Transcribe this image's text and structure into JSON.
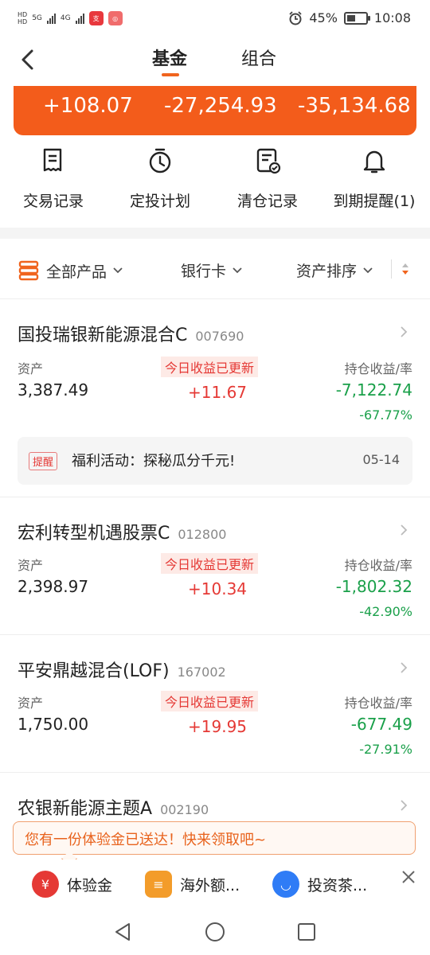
{
  "status_bar": {
    "network_left": "5G",
    "network_right": "4G",
    "app_badge": "支",
    "battery": "45%",
    "battery_level": 0.45,
    "time": "10:08"
  },
  "header": {
    "tabs": [
      {
        "label": "基金",
        "active": true
      },
      {
        "label": "组合",
        "active": false
      }
    ]
  },
  "summary": {
    "values": [
      "+108.07",
      "-27,254.93",
      "-35,134.68"
    ]
  },
  "quick_actions": [
    {
      "label": "交易记录",
      "icon": "receipt-icon"
    },
    {
      "label": "定投计划",
      "icon": "timer-icon"
    },
    {
      "label": "清仓记录",
      "icon": "checked-doc-icon"
    },
    {
      "label": "到期提醒(1)",
      "icon": "bell-icon"
    }
  ],
  "filters": {
    "all_products": "全部产品",
    "bank_card": "银行卡",
    "asset_sort": "资产排序"
  },
  "labels": {
    "asset": "资产",
    "today_updated": "今日收益已更新",
    "holding_profit": "持仓收益/率"
  },
  "funds": [
    {
      "name": "国投瑞银新能源混合C",
      "code": "007690",
      "asset": "3,387.49",
      "today": "+11.67",
      "profit": "-7,122.74",
      "rate": "-67.77%",
      "notice": {
        "tag": "提醒",
        "text": "福利活动：探秘瓜分千元!",
        "date": "05-14"
      }
    },
    {
      "name": "宏利转型机遇股票C",
      "code": "012800",
      "asset": "2,398.97",
      "today": "+10.34",
      "profit": "-1,802.32",
      "rate": "-42.90%"
    },
    {
      "name": "平安鼎越混合(LOF)",
      "code": "167002",
      "asset": "1,750.00",
      "today": "+19.95",
      "profit": "-677.49",
      "rate": "-27.91%"
    },
    {
      "name": "农银新能源主题A",
      "code": "002190"
    }
  ],
  "promo": {
    "text": "您有一份体验金已送达！快来领取吧~"
  },
  "bottom_bar": [
    {
      "label": "体验金",
      "icon": "yuan-icon",
      "color": "#e53935"
    },
    {
      "label": "海外额...",
      "icon": "coins-icon",
      "color": "#f39c2a"
    },
    {
      "label": "投资茶...",
      "icon": "chat-icon",
      "color": "#2f7cf6"
    }
  ],
  "colors": {
    "accent": "#f35c1b",
    "up": "#e53935",
    "down": "#1aa04a"
  }
}
